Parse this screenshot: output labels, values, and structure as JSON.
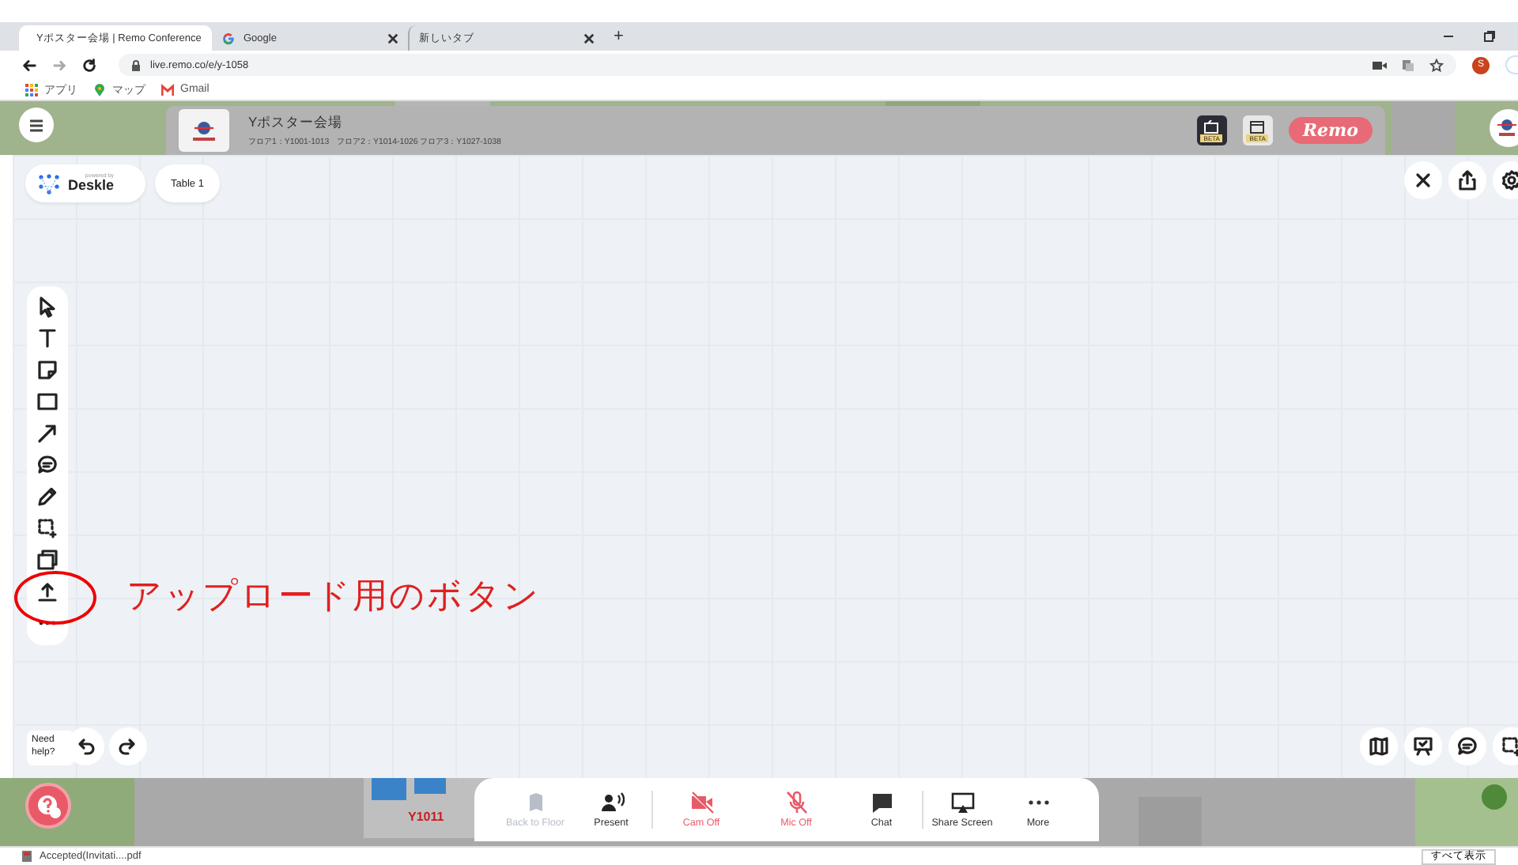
{
  "browser": {
    "tabs": [
      {
        "title": "Yポスター会場 | Remo Conference",
        "kind": "remo",
        "selected": true
      },
      {
        "title": "Google",
        "kind": "google",
        "selected": false
      },
      {
        "title": "新しいタブ",
        "kind": "blank",
        "selected": false
      }
    ],
    "new_tab": "+",
    "url": "live.remo.co/e/y-1058",
    "profile": "S",
    "bookmarks": [
      {
        "label": "アプリ",
        "kind": "apps"
      },
      {
        "label": "マップ",
        "kind": "maps"
      },
      {
        "label": "Gmail",
        "kind": "gmail"
      }
    ]
  },
  "event": {
    "title": "Yポスター会場",
    "subtitle": "フロア1：Y1001-1013　フロア2：Y1014-1026 フロア3：Y1027-1038",
    "badges": [
      "BETA",
      "BETA"
    ],
    "brand": "Remo",
    "floor_label": "Y1011"
  },
  "whiteboard": {
    "powered_by": "powered by",
    "app_name": "Deskle",
    "table": "Table 1",
    "tools": [
      {
        "kind": "pointer"
      },
      {
        "kind": "text"
      },
      {
        "kind": "note"
      },
      {
        "kind": "rectangle"
      },
      {
        "kind": "arrow"
      },
      {
        "kind": "comment"
      },
      {
        "kind": "pencil"
      },
      {
        "kind": "select"
      },
      {
        "kind": "frame"
      },
      {
        "kind": "upload"
      },
      {
        "kind": "more"
      }
    ],
    "annotation": "アップロード用のボタン",
    "help": "Need help?"
  },
  "controls": [
    {
      "label": "Back to Floor",
      "kind": "floor",
      "disabled": true,
      "off": false
    },
    {
      "label": "Present",
      "kind": "present",
      "disabled": false,
      "off": false
    },
    {
      "label": "Cam Off",
      "kind": "cam",
      "disabled": false,
      "off": true
    },
    {
      "label": "Mic Off",
      "kind": "mic",
      "disabled": false,
      "off": true
    },
    {
      "label": "Chat",
      "kind": "chat",
      "disabled": false,
      "off": false
    },
    {
      "label": "Share Screen",
      "kind": "share",
      "disabled": false,
      "off": false
    },
    {
      "label": "More",
      "kind": "more",
      "disabled": false,
      "off": false
    }
  ],
  "downloads": {
    "file": "Accepted(Invitati....pdf",
    "show_all": "すべて表示"
  }
}
